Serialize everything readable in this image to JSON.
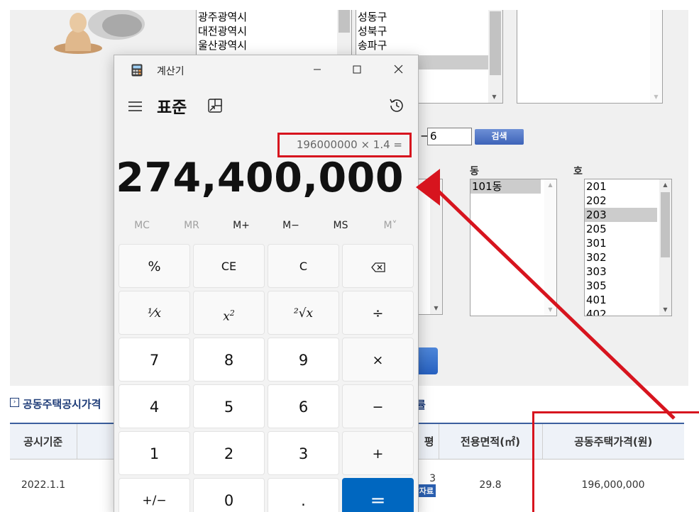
{
  "background_page": {
    "city_list": {
      "items": [
        "광주광역시",
        "대전광역시",
        "울산광역시"
      ]
    },
    "district_list": {
      "items": [
        "성동구",
        "성북구",
        "송파구"
      ]
    },
    "lot_number_to": "6",
    "search_button": "검색",
    "dong_label": "동",
    "ho_label": "호",
    "dong_list": {
      "items": [
        "101동"
      ],
      "selected": "101동"
    },
    "ho_list": {
      "items": [
        "201",
        "202",
        "203",
        "205",
        "301",
        "302",
        "303",
        "305",
        "401",
        "402"
      ],
      "selected": "203"
    },
    "section_title": "공동주택공시가격",
    "section_title_suffix": "률",
    "table": {
      "headers": [
        "공시기준",
        "",
        "",
        "전용면적(㎡)",
        "공동주택가격(원)"
      ],
      "header_fragment": "평",
      "row": {
        "base_date": "2022.1.1",
        "fragment": "3",
        "data_button": "참자료",
        "area": "29.8",
        "price": "196,000,000"
      }
    }
  },
  "calculator": {
    "window_title": "계산기",
    "mode_title": "표준",
    "expression": "196000000 × 1.4 =",
    "result": "274,400,000",
    "memory_buttons": [
      {
        "label": "MC",
        "enabled": false
      },
      {
        "label": "MR",
        "enabled": false
      },
      {
        "label": "M+",
        "enabled": true
      },
      {
        "label": "M−",
        "enabled": true
      },
      {
        "label": "MS",
        "enabled": true
      },
      {
        "label": "M˅",
        "enabled": false
      }
    ],
    "keys": {
      "percent": "%",
      "ce": "CE",
      "clear": "C",
      "reciprocal": "¹⁄x",
      "square": "x",
      "square_sup": "2",
      "sqrt": "²√x",
      "divide": "÷",
      "seven": "7",
      "eight": "8",
      "nine": "9",
      "multiply": "×",
      "four": "4",
      "five": "5",
      "six": "6",
      "minus": "−",
      "one": "1",
      "two": "2",
      "three": "3",
      "plus": "+",
      "negate": "+/−",
      "zero": "0",
      "decimal": ".",
      "equals": "="
    }
  },
  "colors": {
    "annotation_red": "#d7141e",
    "equals_blue": "#0067c0",
    "calc_bg": "#f3f3f3"
  }
}
